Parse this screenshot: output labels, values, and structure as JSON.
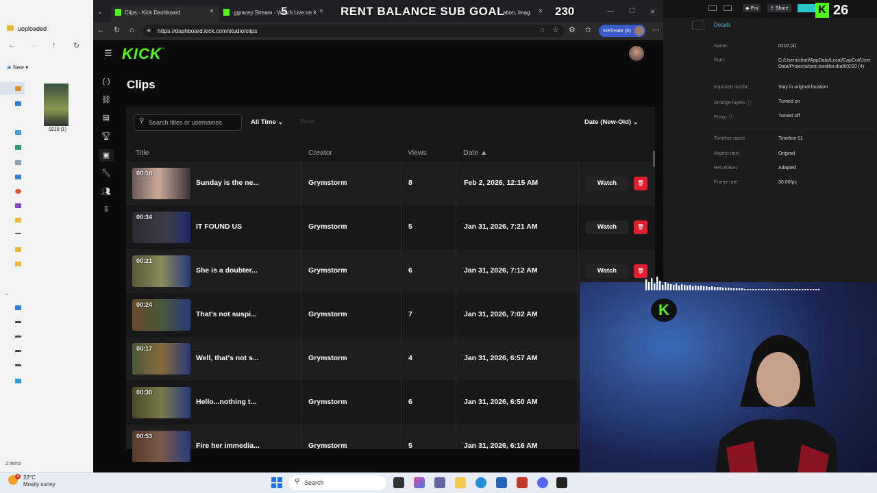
{
  "explorer": {
    "folder_title": "uoploaded",
    "new_label": "New",
    "file_name": "0210 (1)",
    "status": "2 items"
  },
  "taskbar": {
    "weather_temp": "22°C",
    "weather_desc": "Mostly sunny",
    "weather_badge": "4",
    "search_label": "Search"
  },
  "capcut": {
    "pro_label": "Pro",
    "share_label": "Share",
    "details_label": "Details",
    "fields": [
      {
        "k": "Name:",
        "v": "0210 (4)"
      },
      {
        "k": "Path:",
        "v": "C:/Users/charl/AppData/Local/CapCut/User Data/Projects/com.lveditor.draft/0210 (4)"
      },
      {
        "k": "Imported media:",
        "v": "Stay in original location"
      },
      {
        "k": "Arrange layers",
        "v": "Turned on"
      },
      {
        "k": "Proxy:",
        "v": "Turned off"
      },
      {
        "k": "Timeline name",
        "v": "Timeline 01"
      },
      {
        "k": "Aspect ratio:",
        "v": "Original"
      },
      {
        "k": "Resolution:",
        "v": "Adapted"
      },
      {
        "k": "Frame rate:",
        "v": "30.00fps"
      }
    ]
  },
  "browser": {
    "tabs": [
      {
        "label": "Clips - Kick Dashboard"
      },
      {
        "label": "ggracey Stream - Watch Live on Kick"
      },
      {
        "label": "ation, Imag"
      }
    ],
    "url": "https://dashboard.kick.com/studio/clips",
    "inprivate_label": "InPrivate (5)"
  },
  "kick": {
    "logo": "KICK",
    "beta": "BETA",
    "page_title": "Clips",
    "search_placeholder": "Search titles or usernames",
    "time_filter": "All Time",
    "reset_label": "Reset",
    "sort_label": "Date (New-Old)",
    "columns": {
      "title": "Title",
      "creator": "Creator",
      "views": "Views",
      "date": "Date ▲"
    },
    "watch_label": "Watch",
    "clips": [
      {
        "duration": "00:18",
        "title": "Sunday is the ne...",
        "creator": "Grymstorm",
        "views": "8",
        "date": "Feb 2, 2026, 12:15 AM"
      },
      {
        "duration": "00:34",
        "title": "IT FOUND US",
        "creator": "Grymstorm",
        "views": "5",
        "date": "Jan 31, 2026, 7:21 AM"
      },
      {
        "duration": "00:21",
        "title": "She is a doubter...",
        "creator": "Grymstorm",
        "views": "6",
        "date": "Jan 31, 2026, 7:12 AM"
      },
      {
        "duration": "00:24",
        "title": "That's not suspi...",
        "creator": "Grymstorm",
        "views": "7",
        "date": "Jan 31, 2026, 7:02 AM"
      },
      {
        "duration": "00:17",
        "title": "Well, that's not s...",
        "creator": "Grymstorm",
        "views": "4",
        "date": "Jan 31, 2026, 6:57 AM"
      },
      {
        "duration": "00:30",
        "title": "Hello...nothing t...",
        "creator": "Grymstorm",
        "views": "6",
        "date": "Jan 31, 2026, 6:50 AM"
      },
      {
        "duration": "00:53",
        "title": "Fire her immedia...",
        "creator": "Grymstorm",
        "views": "5",
        "date": "Jan 31, 2026, 6:16 AM"
      }
    ]
  },
  "overlay": {
    "goal_text": "RENT BALANCE SUB GOAL",
    "goal_count": "230",
    "goal_current": "5",
    "kick_count": "26",
    "kick_badge": "K"
  },
  "colors": {
    "kick_green": "#53fc18",
    "delete_red": "#e11d2e",
    "inprivate_blue": "#3b5ccc"
  }
}
